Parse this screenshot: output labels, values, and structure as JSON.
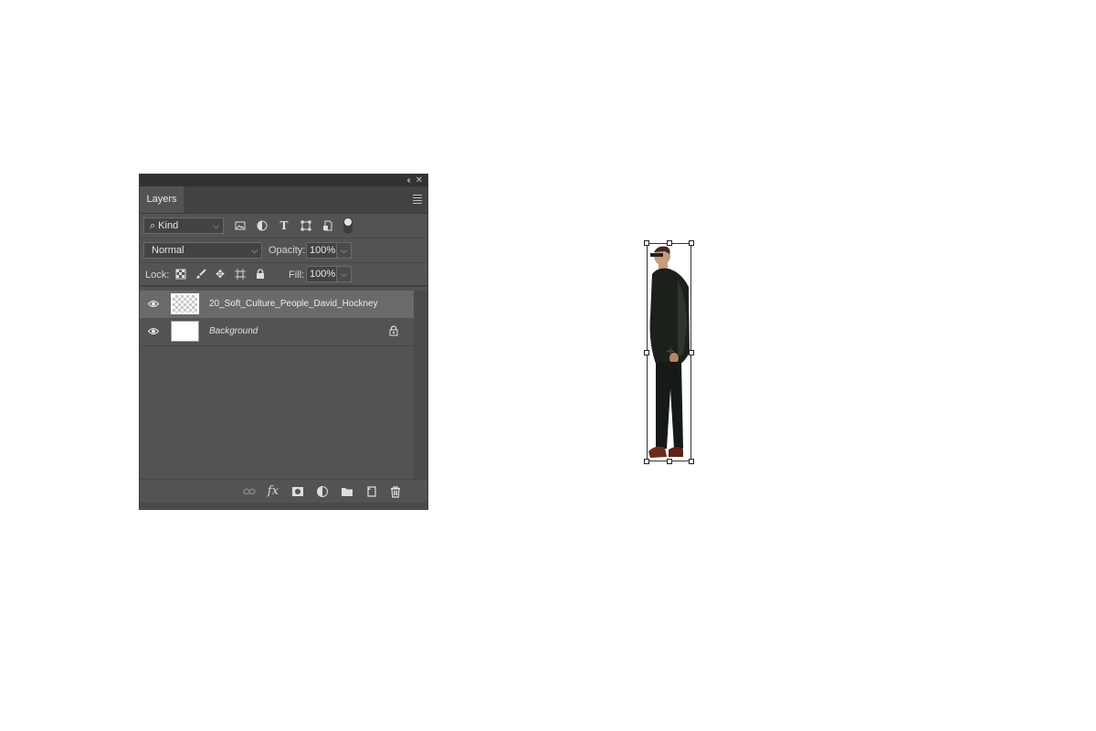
{
  "panel": {
    "tab_label": "Layers",
    "collapse_glyph": "‹‹",
    "close_glyph": "✕",
    "filter": {
      "kind_label": "Kind",
      "icons": [
        "image-filter-icon",
        "adjustment-filter-icon",
        "type-filter-icon",
        "shape-filter-icon",
        "smart-object-filter-icon"
      ]
    },
    "blend_mode": "Normal",
    "opacity_label": "Opacity:",
    "opacity_value": "100%",
    "lock_label": "Lock:",
    "fill_label": "Fill:",
    "fill_value": "100%",
    "layers": [
      {
        "name": "20_Soft_Culture_People_David_Hockney",
        "visible": true,
        "selected": true
      },
      {
        "name": "Background",
        "visible": true,
        "locked": true
      }
    ],
    "bottom_icons": [
      "link-layers-icon",
      "fx-icon",
      "add-mask-icon",
      "adjustment-layer-icon",
      "new-group-icon",
      "new-layer-icon",
      "delete-layer-icon"
    ]
  },
  "colors": {
    "panel_bg": "#535353",
    "selected_layer": "#6a6a6a",
    "canvas_bg": "#ffffff"
  }
}
